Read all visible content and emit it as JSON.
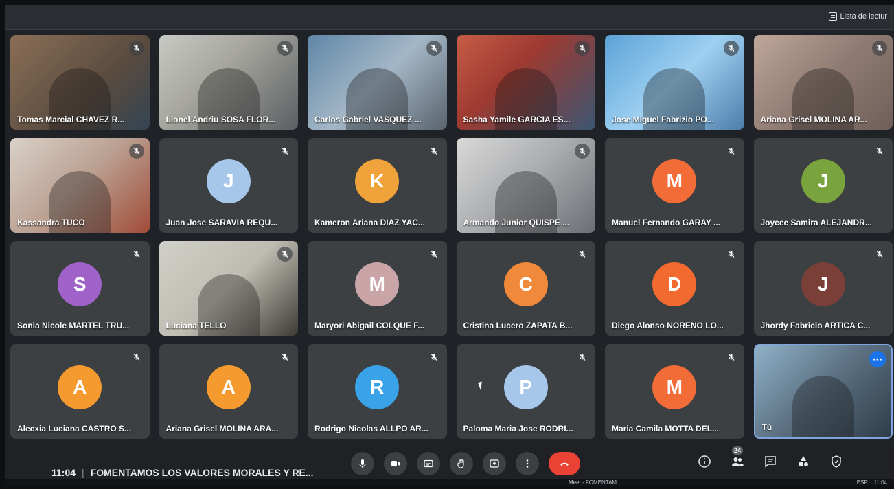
{
  "browser": {
    "reading_list_label": "Lista de lectur"
  },
  "participants": [
    {
      "name": "Tomas Marcial CHAVEZ R...",
      "type": "video",
      "muted": true
    },
    {
      "name": "Lionel Andriu SOSA FLOR...",
      "type": "video",
      "muted": true
    },
    {
      "name": "Carlos Gabriel VASQUEZ ...",
      "type": "video",
      "muted": true
    },
    {
      "name": "Sasha Yamile GARCIA ES...",
      "type": "video",
      "muted": true
    },
    {
      "name": "Jose Miguel Fabrizio PO...",
      "type": "video",
      "muted": true
    },
    {
      "name": "Ariana Grisel MOLINA AR...",
      "type": "video",
      "muted": true
    },
    {
      "name": "Kassandra TUCO",
      "type": "video",
      "muted": true
    },
    {
      "name": "Juan Jose SARAVIA REQU...",
      "type": "avatar",
      "initial": "J",
      "color": "#a6c6ea",
      "muted": true
    },
    {
      "name": "Kameron Ariana DIAZ YAC...",
      "type": "avatar",
      "initial": "K",
      "color": "#f0a33a",
      "muted": true
    },
    {
      "name": "Armando Junior QUISPE ...",
      "type": "video",
      "muted": true
    },
    {
      "name": "Manuel Fernando GARAY ...",
      "type": "avatar",
      "initial": "M",
      "color": "#f26c38",
      "muted": true
    },
    {
      "name": "Joycee Samira ALEJANDR...",
      "type": "avatar",
      "initial": "J",
      "color": "#79a33c",
      "muted": true
    },
    {
      "name": "Sonia Nicole MARTEL TRU...",
      "type": "avatar",
      "initial": "S",
      "color": "#9e62c9",
      "muted": true
    },
    {
      "name": "Luciana TELLO",
      "type": "video",
      "muted": true
    },
    {
      "name": "Maryori Abigail COLQUE F...",
      "type": "avatar",
      "initial": "M",
      "color": "#c9a5a8",
      "muted": true
    },
    {
      "name": "Cristina Lucero ZAPATA B...",
      "type": "avatar",
      "initial": "C",
      "color": "#f08a3a",
      "muted": true
    },
    {
      "name": "Diego Alonso NORENO LO...",
      "type": "avatar",
      "initial": "D",
      "color": "#f26a2f",
      "muted": true
    },
    {
      "name": "Jhordy Fabricio ARTICA C...",
      "type": "avatar",
      "initial": "J",
      "color": "#7a3f36",
      "muted": true
    },
    {
      "name": "Alecxia Luciana CASTRO S...",
      "type": "avatar",
      "initial": "A",
      "color": "#f59a2e",
      "muted": true
    },
    {
      "name": "Ariana Grisel MOLINA ARA...",
      "type": "avatar",
      "initial": "A",
      "color": "#f59a2e",
      "muted": true
    },
    {
      "name": "Rodrigo Nicolas ALLPO AR...",
      "type": "avatar",
      "initial": "R",
      "color": "#3aa3e8",
      "muted": true
    },
    {
      "name": "Paloma Maria Jose RODRI...",
      "type": "avatar",
      "initial": "P",
      "color": "#a6c6ea",
      "muted": true
    },
    {
      "name": "Maria Camila MOTTA DEL...",
      "type": "avatar",
      "initial": "M",
      "color": "#f26c38",
      "muted": true
    },
    {
      "name": "Tú",
      "type": "self",
      "muted": false
    }
  ],
  "meeting": {
    "time": "11:04",
    "separator": "|",
    "title": "FOMENTAMOS LOS VALORES MORALES Y RE..."
  },
  "controls": {
    "mic_icon": "mic-icon",
    "camera_icon": "camera-icon",
    "captions_icon": "captions-icon",
    "raise_hand_icon": "raise-hand-icon",
    "present_icon": "present-icon",
    "more_icon": "more-options-icon",
    "end_icon": "end-call-icon"
  },
  "right_panel": {
    "participants_count": "24",
    "info_icon": "info-icon",
    "people_icon": "people-icon",
    "chat_icon": "chat-icon",
    "activities_icon": "activities-icon",
    "security_icon": "shield-icon"
  },
  "taskbar": {
    "meet_item": "Meet - FOMENTAM",
    "lang": "ESP",
    "clock": "11:04"
  },
  "colors": {
    "end_call": "#ea4335",
    "self_border": "#7fa5dc",
    "tile_bg": "#3c4043"
  }
}
